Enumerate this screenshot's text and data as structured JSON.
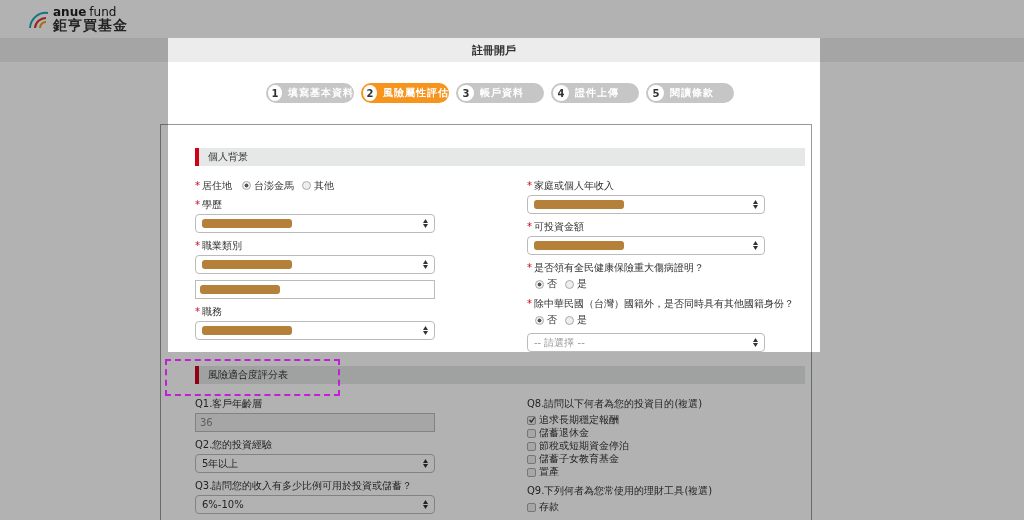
{
  "header": {
    "logo": {
      "brand": "anue",
      "suffix": "fund",
      "subtitle": "鉅亨買基金"
    }
  },
  "page_title": "註冊開戶",
  "steps": [
    {
      "number": "1",
      "label": "填寫基本資料",
      "selected": false
    },
    {
      "number": "2",
      "label": "風險屬性評估",
      "selected": true
    },
    {
      "number": "3",
      "label": "帳戶資料",
      "selected": false
    },
    {
      "number": "4",
      "label": "證件上傳",
      "selected": false
    },
    {
      "number": "5",
      "label": "閱讀條款",
      "selected": false
    }
  ],
  "sections": [
    {
      "title": "個人背景",
      "highlighted": false,
      "columns": [
        [
          {
            "kind": "radio",
            "label": "居住地",
            "marker": "*",
            "inline": true,
            "options": [
              {
                "label": "台澎金馬",
                "selected": true
              },
              {
                "label": "其他",
                "selected": false
              }
            ]
          },
          {
            "kind": "select",
            "label": "學歷",
            "marker": "*",
            "redacted": true
          },
          {
            "kind": "select",
            "label": "職業類別",
            "marker": "*",
            "redacted": true
          },
          {
            "kind": "text",
            "redacted": true
          },
          {
            "kind": "select",
            "label": "職務",
            "marker": "*",
            "redacted": true
          }
        ],
        [
          {
            "kind": "select",
            "label": "家庭或個人年收入",
            "marker": "*",
            "redacted": true
          },
          {
            "kind": "select",
            "label": "可投資金額",
            "marker": "*",
            "redacted": true
          },
          {
            "kind": "radio",
            "label": "是否領有全民健康保險重大傷病證明？",
            "marker": "*",
            "inline": false,
            "options": [
              {
                "label": "否",
                "selected": true
              },
              {
                "label": "是",
                "selected": false
              }
            ]
          },
          {
            "kind": "radio",
            "label": "除中華民國（台灣）國籍外，是否同時具有其他國籍身份？",
            "marker": "*",
            "inline": false,
            "options": [
              {
                "label": "否",
                "selected": true
              },
              {
                "label": "是",
                "selected": false
              }
            ]
          },
          {
            "kind": "select",
            "placeholder": "-- 請選擇 --",
            "disabled": true
          }
        ]
      ]
    },
    {
      "title": "風險適合度評分表",
      "highlighted": true,
      "columns": [
        [
          {
            "kind": "text",
            "label": "Q1.客戶年齡層",
            "value": "36",
            "disabled": true
          },
          {
            "kind": "select",
            "label": "Q2.您的投資經驗",
            "value": "5年以上"
          },
          {
            "kind": "select",
            "label": "Q3.請問您的收入有多少比例可用於投資或儲蓄？",
            "value": "6%-10%"
          }
        ],
        [
          {
            "kind": "checkboxes",
            "label": "Q8.請問以下何者為您的投資目的(複選)",
            "options": [
              {
                "label": "追求長期穩定報酬",
                "checked": true
              },
              {
                "label": "儲蓄退休金",
                "checked": false
              },
              {
                "label": "節稅或短期資金停泊",
                "checked": false
              },
              {
                "label": "儲蓄子女教育基金",
                "checked": false
              },
              {
                "label": "置產",
                "checked": false
              }
            ]
          },
          {
            "kind": "checkboxes",
            "label": "Q9.下列何者為您常使用的理財工具(複選)",
            "options": [
              {
                "label": "存款",
                "checked": false
              }
            ]
          }
        ]
      ]
    }
  ]
}
